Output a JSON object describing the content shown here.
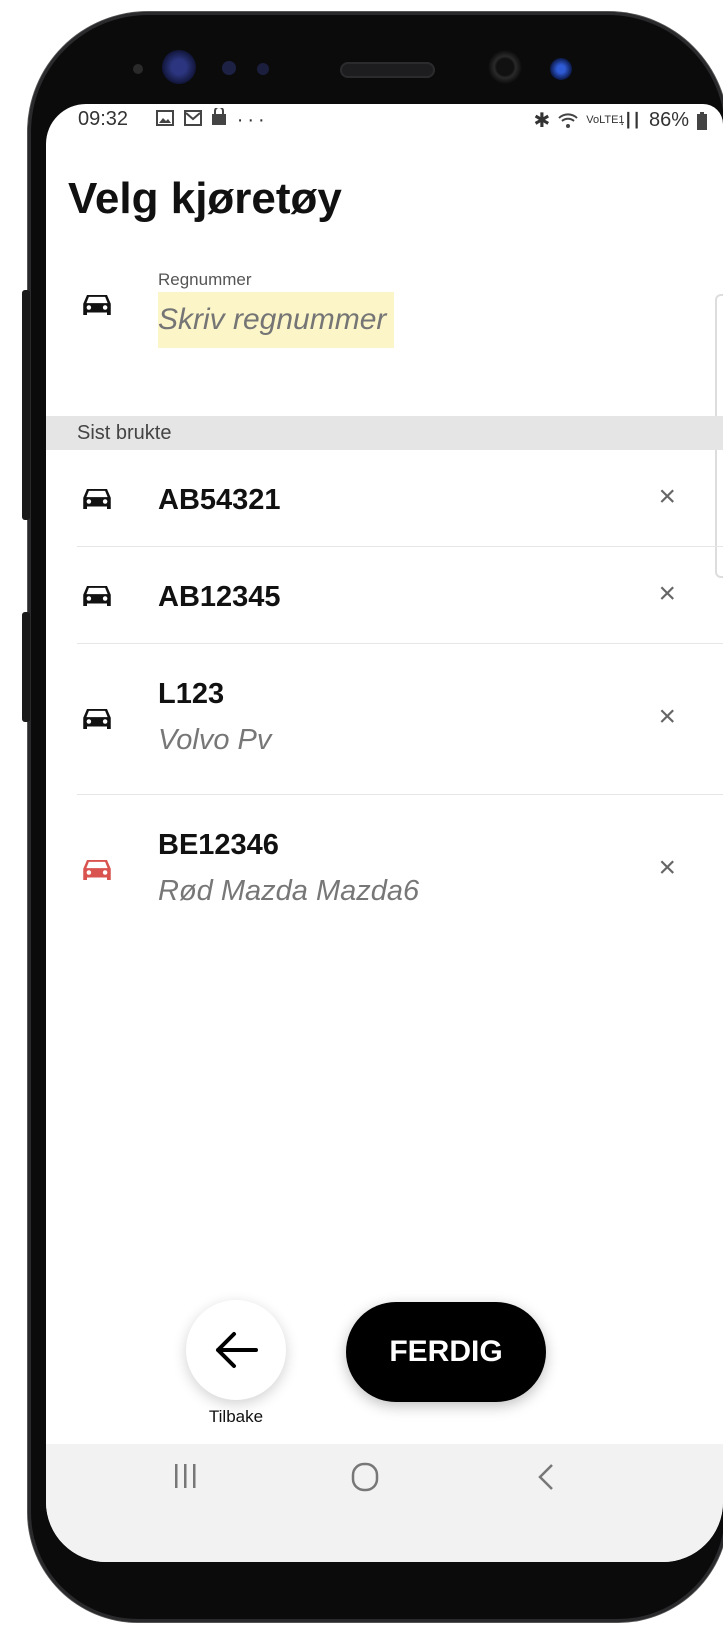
{
  "status_bar": {
    "time": "09:32",
    "left_icons": [
      "image-icon",
      "mail-icon",
      "bag-icon"
    ],
    "more": "···",
    "bluetooth": "✱",
    "network": "VoLTE1",
    "signal": ".┃┃",
    "battery": "86%"
  },
  "page": {
    "title": "Velg kjøretøy"
  },
  "reg_input": {
    "label": "Regnummer",
    "placeholder": "Skriv regnummer"
  },
  "section": {
    "recent_label": "Sist brukte"
  },
  "vehicles": [
    {
      "plate": "AB54321",
      "description": "",
      "icon_color": "#111111"
    },
    {
      "plate": "AB12345",
      "description": "",
      "icon_color": "#111111"
    },
    {
      "plate": "L123",
      "description": "Volvo Pv",
      "icon_color": "#111111"
    },
    {
      "plate": "BE12346",
      "description": "Rød Mazda Mazda6",
      "icon_color": "#d9534f"
    }
  ],
  "remove_glyph": "×",
  "actions": {
    "back_label": "Tilbake",
    "done_label": "FERDIG"
  },
  "colors": {
    "input_highlight": "#fbf5c7",
    "section_bg": "#e5e5e5",
    "red_vehicle": "#d9534f"
  }
}
